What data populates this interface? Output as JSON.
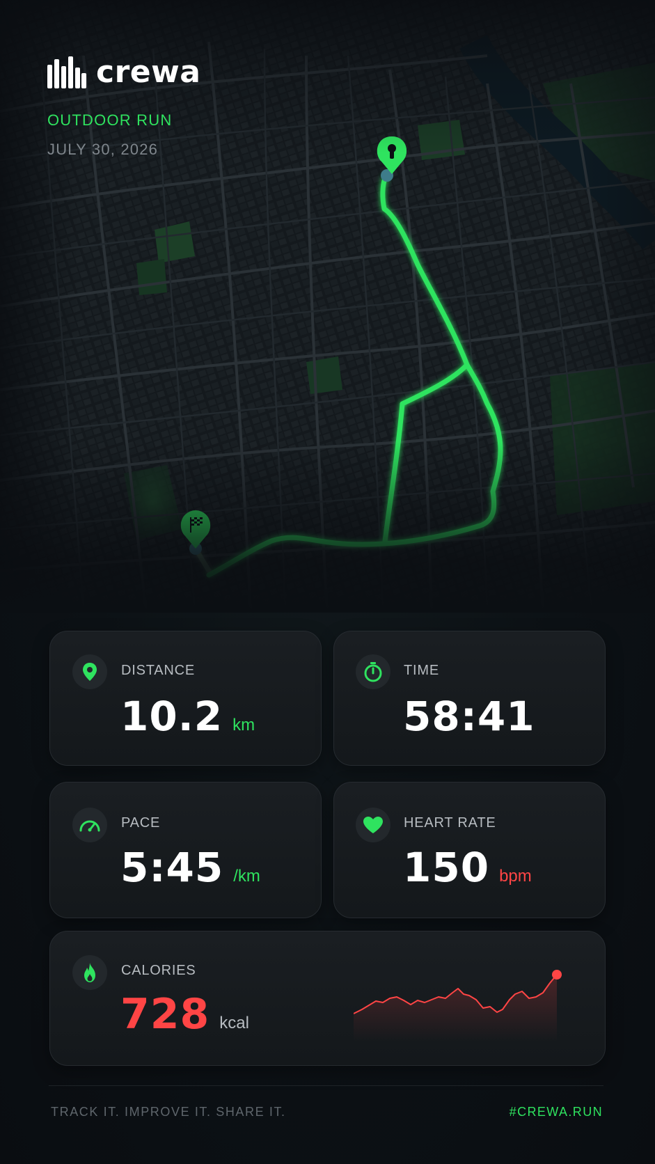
{
  "brand": {
    "name": "crewa"
  },
  "activity": {
    "type": "OUTDOOR RUN",
    "date": "JULY 30, 2026"
  },
  "map": {
    "start_marker_icon": "keyhole-pin-icon",
    "finish_marker_icon": "checkered-flag-icon",
    "route_color": "#2fe35f"
  },
  "stats": {
    "distance": {
      "label": "DISTANCE",
      "value": "10.2",
      "unit": "km",
      "icon": "location-pin-icon"
    },
    "time": {
      "label": "TIME",
      "value": "58:41",
      "icon": "stopwatch-icon"
    },
    "pace": {
      "label": "PACE",
      "value": "5:45",
      "unit": "/km",
      "icon": "speedometer-icon"
    },
    "heart_rate": {
      "label": "HEART RATE",
      "value": "150",
      "unit": "bpm",
      "icon": "heart-icon"
    },
    "calories": {
      "label": "CALORIES",
      "value": "728",
      "unit": "kcal",
      "icon": "flame-icon"
    }
  },
  "colors": {
    "accent": "#2fe35f",
    "alert": "#ff4545",
    "background": "#0b0f13",
    "card": "#171b1f"
  },
  "footer": {
    "tagline": "TRACK IT. IMPROVE IT. SHARE IT.",
    "hashtag": "#CREWA.RUN"
  }
}
